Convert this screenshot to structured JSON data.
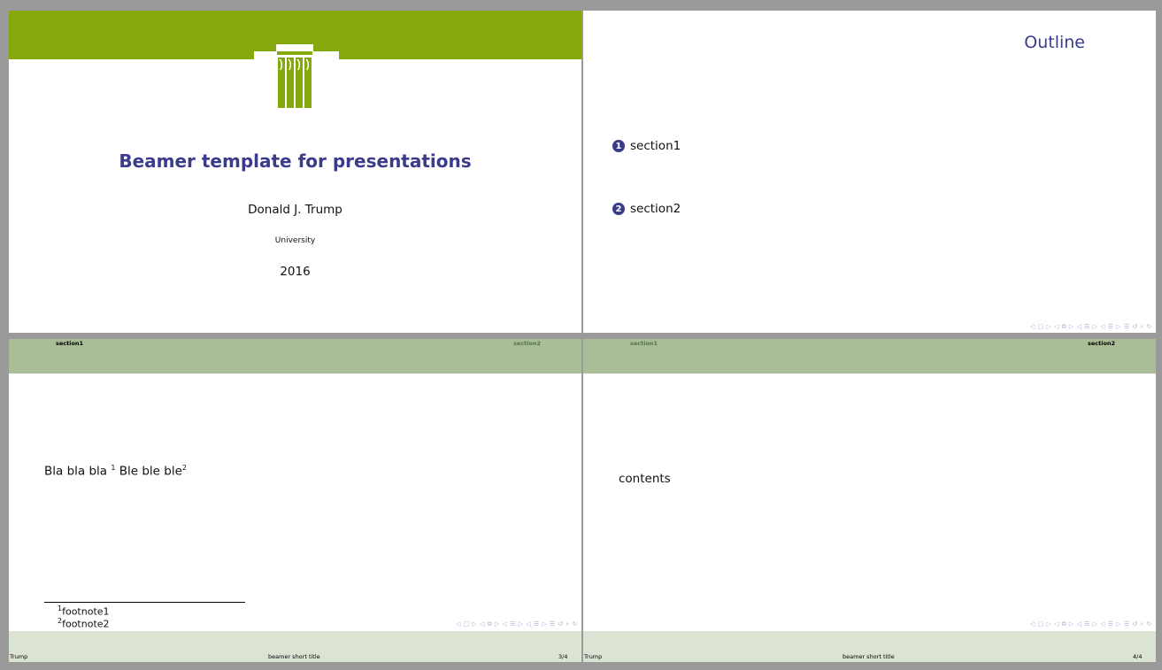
{
  "title_slide": {
    "title": "Beamer template for presentations",
    "author": "Donald J. Trump",
    "institute": "University",
    "date": "2016"
  },
  "outline_slide": {
    "title": "Outline",
    "items": [
      {
        "num": "1",
        "label": "section1"
      },
      {
        "num": "2",
        "label": "section2"
      }
    ]
  },
  "slide3": {
    "header": {
      "left": "section1",
      "right": "section2"
    },
    "text_a": "Bla bla bla ",
    "sup_a": "1",
    "text_b": " Ble ble ble",
    "sup_b": "2",
    "footnotes": [
      {
        "mark": "1",
        "text": "footnote1"
      },
      {
        "mark": "2",
        "text": "footnote2"
      }
    ],
    "footer": {
      "left": "Trump",
      "center": "beamer short title",
      "right": "3/4"
    }
  },
  "slide4": {
    "header": {
      "left": "section1",
      "right": "section2"
    },
    "content": "contents",
    "footer": {
      "left": "Trump",
      "center": "beamer short title",
      "right": "4/4"
    }
  },
  "colors": {
    "green_bar": "#85a90c",
    "header_green": "#a9be96",
    "footer_green": "#dbe3d3",
    "title_blue": "#3b3b8c"
  },
  "nav_symbols": "◁ □ ▷ ◁ ⧉ ▷ ◁ ☰ ▷ ◁ ☰ ▷  ☰  ↺ ⌕ ↻"
}
